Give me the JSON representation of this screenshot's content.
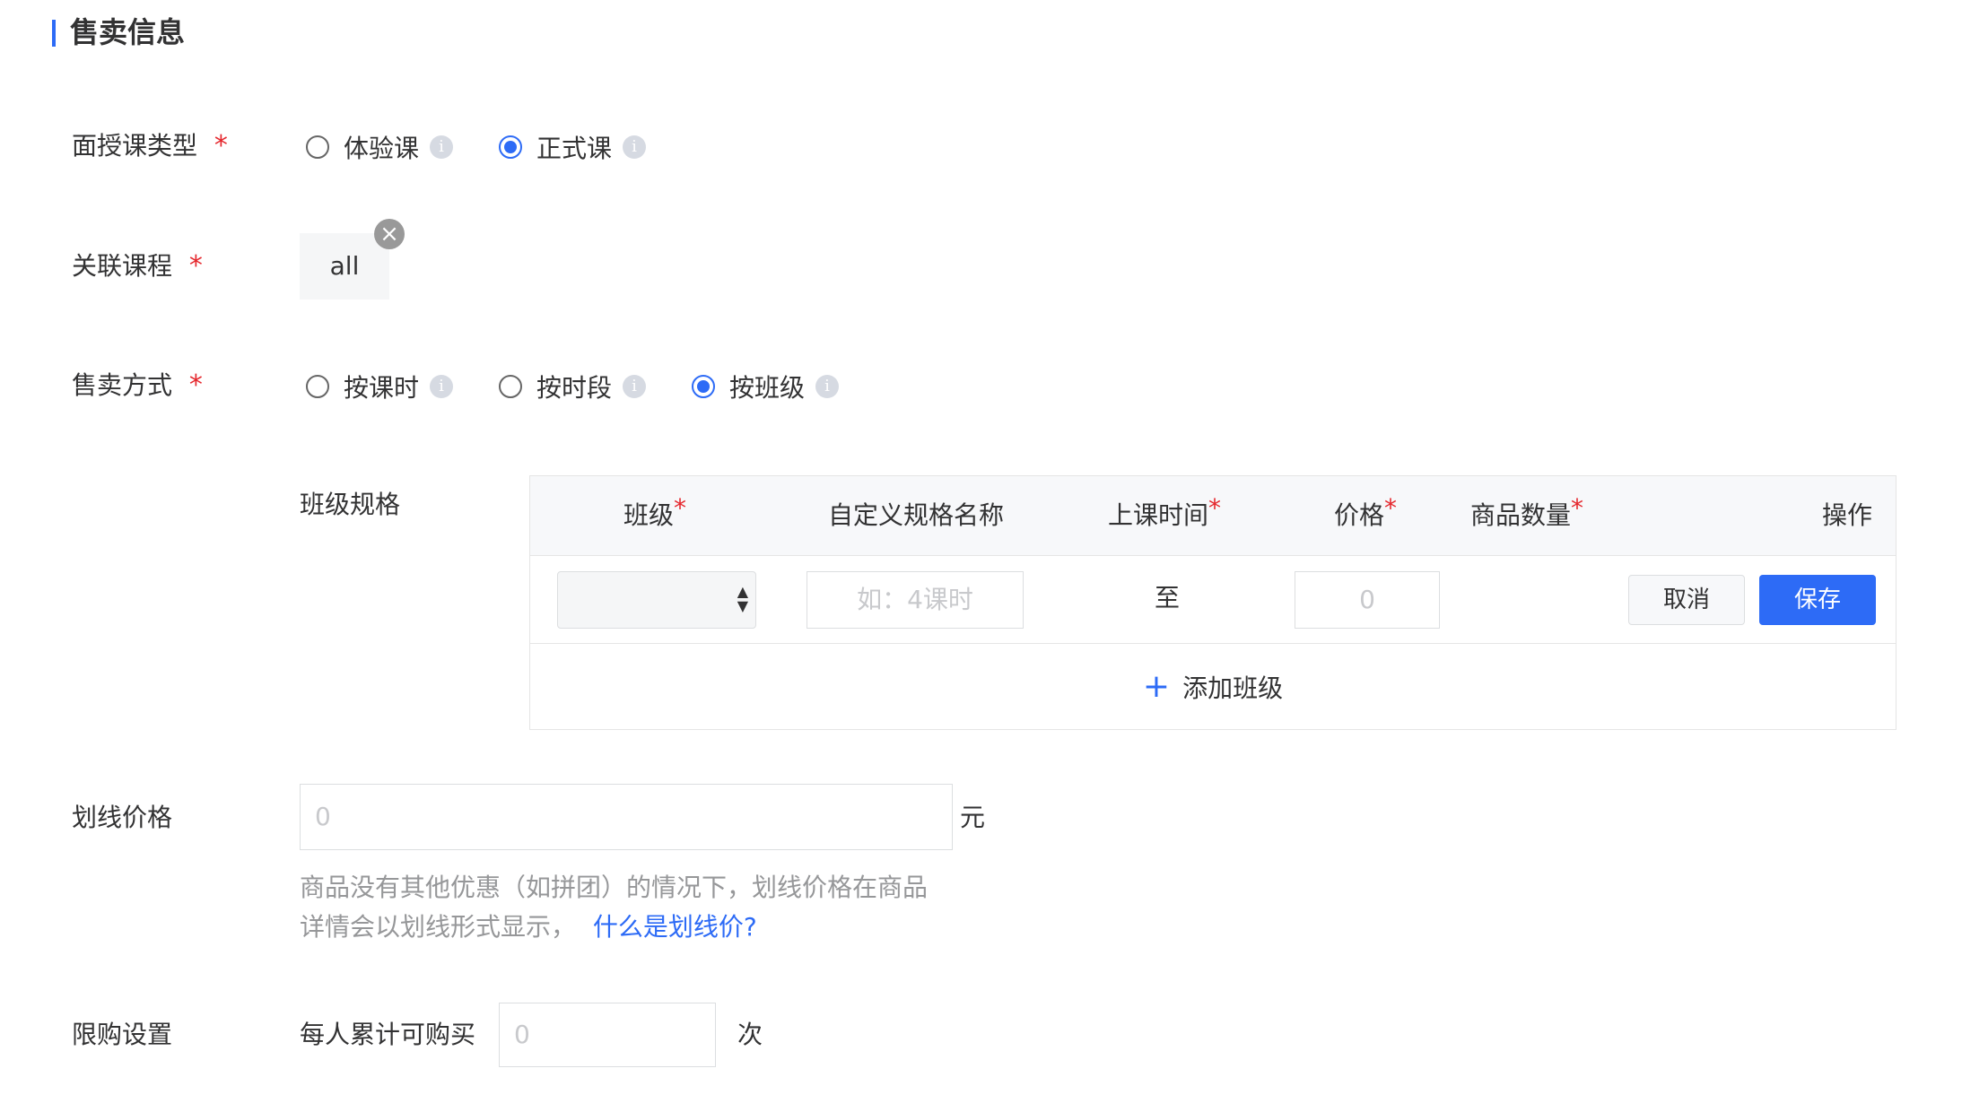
{
  "section": {
    "title": "售卖信息"
  },
  "course_type": {
    "label": "面授课类型",
    "required": "*",
    "options": [
      {
        "label": "体验课",
        "checked": false
      },
      {
        "label": "正式课",
        "checked": true
      }
    ]
  },
  "related_course": {
    "label": "关联课程",
    "required": "*",
    "tag": "all"
  },
  "sale_method": {
    "label": "售卖方式",
    "required": "*",
    "options": [
      {
        "label": "按课时",
        "checked": false
      },
      {
        "label": "按时段",
        "checked": false
      },
      {
        "label": "按班级",
        "checked": true
      }
    ]
  },
  "class_spec": {
    "label": "班级规格",
    "headers": {
      "class": "班级",
      "custom_name": "自定义规格名称",
      "time": "上课时间",
      "price": "价格",
      "quantity": "商品数量",
      "action": "操作"
    },
    "required_mark": "*",
    "row": {
      "name_placeholder": "如：4课时",
      "time_separator": "至",
      "price_placeholder": "0",
      "cancel": "取消",
      "save": "保存"
    },
    "add_label": "添加班级"
  },
  "strike_price": {
    "label": "划线价格",
    "placeholder": "0",
    "unit": "元",
    "hint_line1": "商品没有其他优惠（如拼团）的情况下，划线价格在商品",
    "hint_line2": "详情会以划线形式显示，",
    "hint_link": "什么是划线价?"
  },
  "purchase_limit": {
    "label": "限购设置",
    "prefix": "每人累计可购买",
    "placeholder": "0",
    "unit": "次"
  },
  "colors": {
    "accent": "#2d6bf6",
    "required": "#e5272d"
  }
}
